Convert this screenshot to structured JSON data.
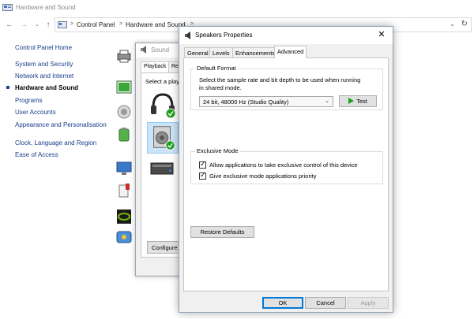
{
  "window": {
    "title": "Hardware and Sound"
  },
  "address": {
    "crumbs": [
      "Control Panel",
      "Hardware and Sound"
    ],
    "separator": ">"
  },
  "nav": {
    "home": "Control Panel Home",
    "items": [
      "System and Security",
      "Network and Internet",
      "Hardware and Sound",
      "Programs",
      "User Accounts",
      "Appearance and Personalisation",
      "Clock, Language and Region",
      "Ease of Access"
    ],
    "active_index": 2
  },
  "sound_dialog": {
    "title": "Sound",
    "tabs": [
      "Playback",
      "Rec"
    ],
    "selected_tab": "Playback",
    "list_label": "Select a playl",
    "configure_label": "Configure"
  },
  "speakers_dialog": {
    "title": "Speakers Properties",
    "tabs": [
      "General",
      "Levels",
      "Enhancements",
      "Advanced"
    ],
    "selected_tab": "Advanced",
    "default_format": {
      "label": "Default Format",
      "description_line1": "Select the sample rate and bit depth to be used when running",
      "description_line2": "in shared mode.",
      "selected_value": "24 bit, 48000 Hz (Studio Quality)",
      "test_label": "Test"
    },
    "exclusive_mode": {
      "label": "Exclusive Mode",
      "option1": {
        "label": "Allow applications to take exclusive control of this device",
        "checked": true
      },
      "option2": {
        "label": "Give exclusive mode applications priority",
        "checked": true
      }
    },
    "restore_defaults_label": "Restore Defaults",
    "ok_label": "OK",
    "cancel_label": "Cancel",
    "apply_label": "Apply"
  },
  "colors": {
    "link": "#1a3d8c",
    "accent": "#0078d7",
    "test_green": "#1e9e1e"
  }
}
